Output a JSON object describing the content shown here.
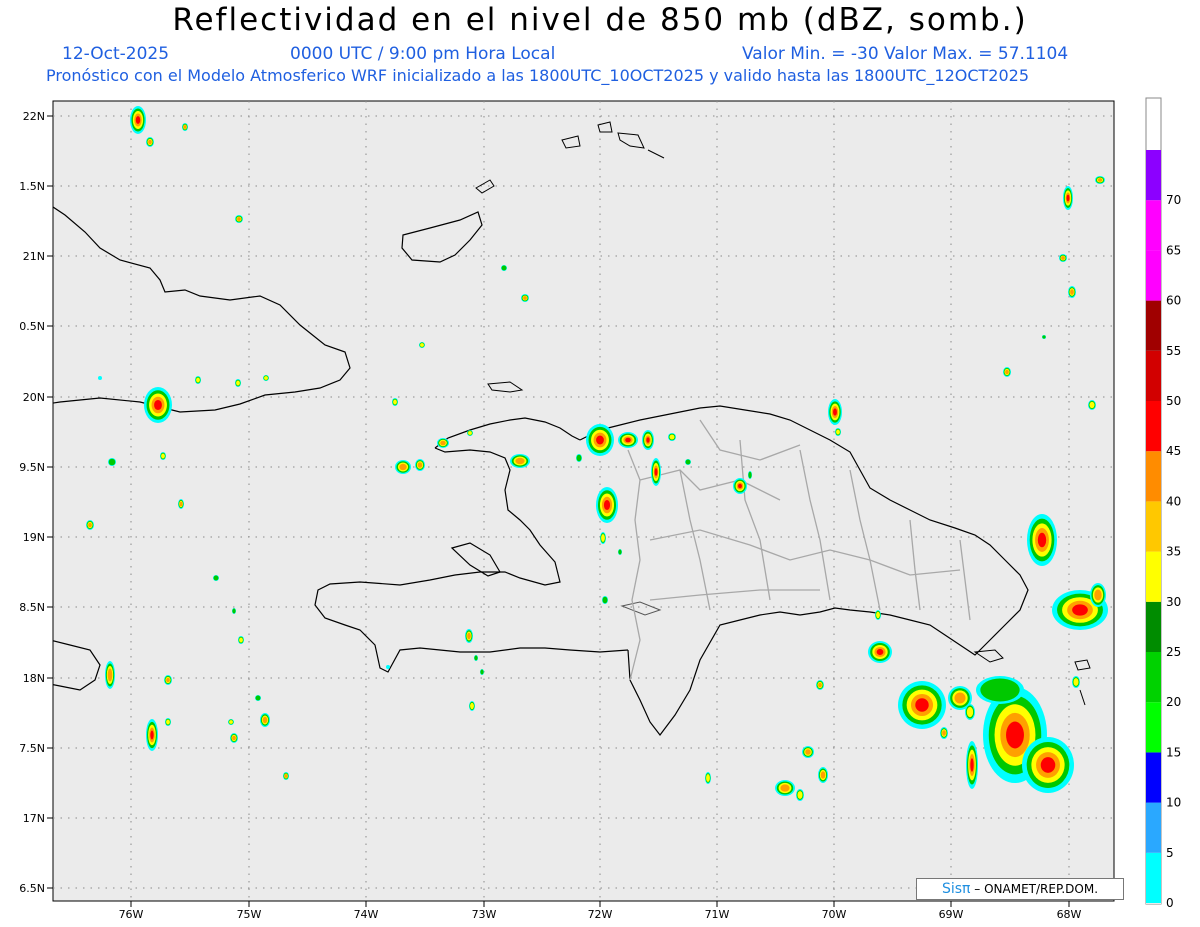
{
  "title": "Reflectividad en el nivel de 850 mb (dBZ, somb.)",
  "date": "12-Oct-2025",
  "time": "0000 UTC / 9:00 pm Hora Local",
  "minmax": "Valor Min. = -30  Valor Max. = 57.1104",
  "model_line": "Pronóstico con el Modelo Atmosferico WRF inicializado a las 1800UTC_10OCT2025 y valido hasta las  1800UTC_12OCT2025",
  "credit": {
    "logo": "Sisπ",
    "text": "– ONAMET/REP.DOM."
  },
  "axes": {
    "lon_labels": [
      "76W",
      "75W",
      "74W",
      "73W",
      "72W",
      "71W",
      "70W",
      "69W",
      "68W"
    ],
    "lat_labels": [
      "22N",
      "1.5N",
      "21N",
      "0.5N",
      "20N",
      "9.5N",
      "19N",
      "8.5N",
      "18N",
      "7.5N",
      "17N",
      "6.5N"
    ]
  },
  "colorbar": {
    "labels": [
      "0",
      "5",
      "10",
      "15",
      "20",
      "25",
      "30",
      "35",
      "40",
      "45",
      "50",
      "55",
      "60",
      "65",
      "70"
    ],
    "colors": [
      "#00ffff",
      "#2aa8ff",
      "#0000ff",
      "#00ff00",
      "#00d200",
      "#008c00",
      "#ffff00",
      "#ffc800",
      "#ff8c00",
      "#ff0000",
      "#d20000",
      "#a00000",
      "#ff00ff",
      "#ff00ff",
      "#8c00ff"
    ]
  }
}
